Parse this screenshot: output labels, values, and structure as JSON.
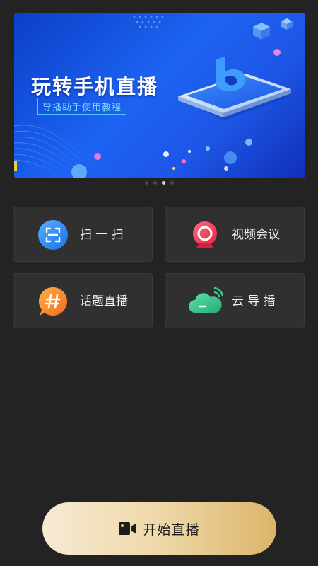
{
  "banner": {
    "title": "玩转手机直播",
    "subtitle": "导播助手使用教程",
    "icon": "phone-with-logo-illustration",
    "slide_count": 4,
    "active_slide": 3
  },
  "tiles": [
    {
      "label": "扫 一 扫",
      "icon": "scan-icon",
      "color": "#2f8cf0"
    },
    {
      "label": "视频会议",
      "icon": "webcam-icon",
      "color": "#ee3d56"
    },
    {
      "label": "话题直播",
      "icon": "hashtag-chat-icon",
      "color": "#f58a2b"
    },
    {
      "label": "云 导 播",
      "icon": "cloud-broadcast-icon",
      "color": "#35c28a"
    }
  ],
  "start_button": {
    "label": "开始直播",
    "icon": "video-camera-icon"
  }
}
